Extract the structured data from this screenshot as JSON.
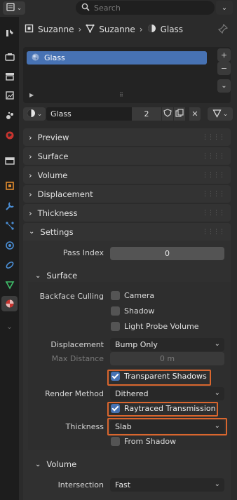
{
  "topbar": {
    "search_placeholder": "Search"
  },
  "breadcrumb": [
    {
      "label": "Suzanne",
      "icon": "object-icon"
    },
    {
      "label": "Suzanne",
      "icon": "mesh-data-icon"
    },
    {
      "label": "Glass",
      "icon": "material-sphere-icon"
    }
  ],
  "material_slots": [
    {
      "name": "Glass",
      "selected": true
    }
  ],
  "datablock": {
    "name": "Glass",
    "users": "2"
  },
  "panels": {
    "preview": "Preview",
    "surface": "Surface",
    "volume": "Volume",
    "displacement": "Displacement",
    "thickness": "Thickness",
    "settings": "Settings"
  },
  "settings": {
    "pass_index_label": "Pass Index",
    "pass_index_value": "0",
    "surface_sub": "Surface",
    "backface_culling_label": "Backface Culling",
    "camera_label": "Camera",
    "camera_checked": false,
    "shadow_label": "Shadow",
    "shadow_checked": false,
    "light_probe_label": "Light Probe Volume",
    "light_probe_checked": false,
    "displacement_label": "Displacement",
    "displacement_value": "Bump Only",
    "max_distance_label": "Max Distance",
    "max_distance_value": "0 m",
    "transparent_shadows_label": "Transparent Shadows",
    "transparent_shadows_checked": true,
    "render_method_label": "Render Method",
    "render_method_value": "Dithered",
    "raytraced_transmission_label": "Raytraced Transmission",
    "raytraced_transmission_checked": true,
    "thickness_label": "Thickness",
    "thickness_value": "Slab",
    "from_shadow_label": "From Shadow",
    "from_shadow_checked": false,
    "volume_sub": "Volume",
    "intersection_label": "Intersection",
    "intersection_value": "Fast"
  },
  "colors": {
    "accent": "#4772b3",
    "highlight": "#d9662e",
    "background": "#2b2b2b"
  }
}
